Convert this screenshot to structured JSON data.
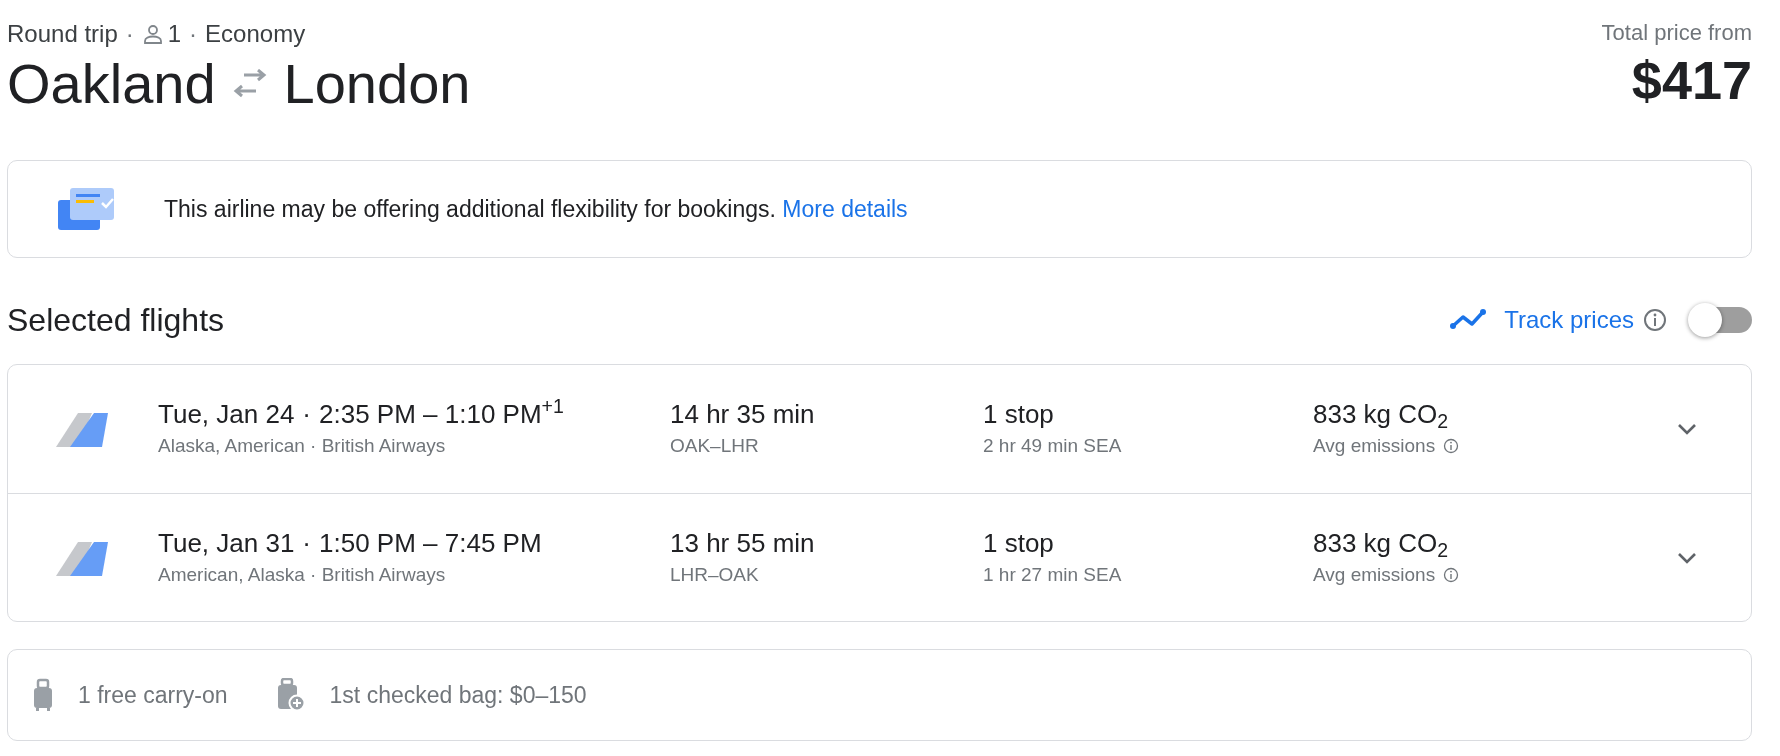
{
  "trip": {
    "type": "Round trip",
    "passengers": "1",
    "cabin": "Economy",
    "separators": [
      "·",
      "·"
    ]
  },
  "route": {
    "origin": "Oakland",
    "destination": "London"
  },
  "price": {
    "label": "Total price from",
    "amount": "$417"
  },
  "notice": {
    "text": "This airline may be offering additional flexibility for bookings.",
    "link": "More details"
  },
  "selected_flights": {
    "title": "Selected flights",
    "track_prices": {
      "label": "Track prices",
      "on": false
    },
    "flights": [
      {
        "date": "Tue, Jan 24",
        "separator": "·",
        "times": "2:35 PM – 1:10 PM$^{+1}$",
        "airlines": "Alaska, American · British Airways",
        "duration": "14 hr 35 min",
        "route": "OAK–LHR",
        "stops": "1 stop",
        "layover": "2 hr 49 min SEA",
        "emissions": "833 kg CO$_{2}$",
        "emissions_label": "Avg emissions",
        "expanded": false
      },
      {
        "date": "Tue, Jan 31",
        "separator": "·",
        "times": "1:50 PM – 7:45 PM",
        "airlines": "American, Alaska · British Airways",
        "duration": "13 hr 55 min",
        "route": "LHR–OAK",
        "stops": "1 stop",
        "layover": "1 hr 27 min SEA",
        "emissions": "833 kg CO$_{2}$",
        "emissions_label": "Avg emissions",
        "expanded": false
      }
    ]
  },
  "baggage": [
    {
      "kind": "carry_on",
      "text": "1 free carry-on"
    },
    {
      "kind": "checked",
      "text": "1st checked bag: $0–150"
    }
  ]
}
